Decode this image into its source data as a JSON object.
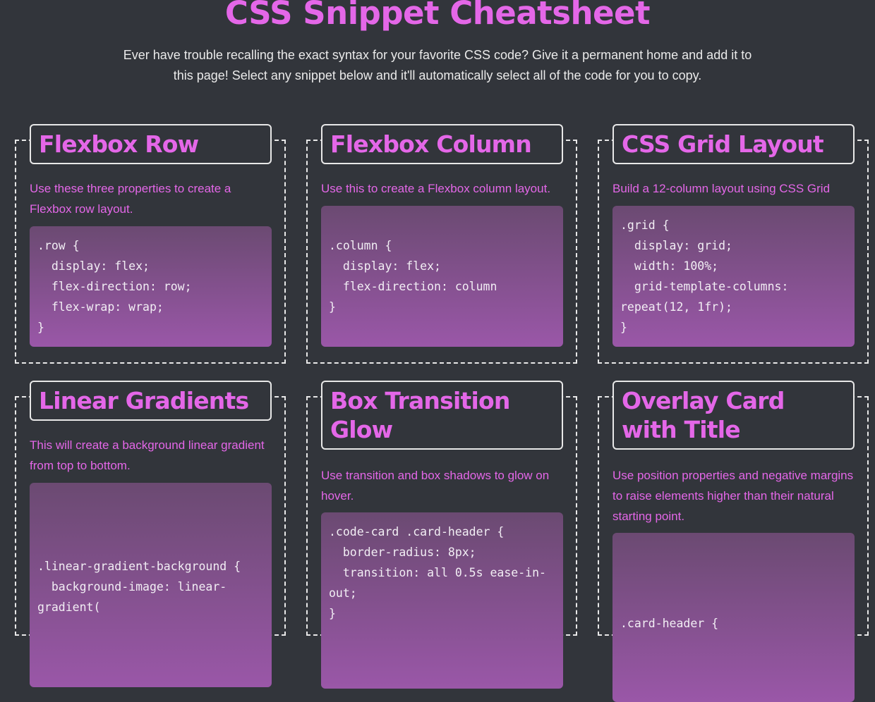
{
  "page": {
    "title": "CSS Snippet Cheatsheet",
    "intro": "Ever have trouble recalling the exact syntax for your favorite CSS code? Give it a permanent home and add it to this page! Select any snippet below and it'll automatically select all of the code for you to copy."
  },
  "cards": [
    {
      "title": "Flexbox Row",
      "description": "Use these three properties to create a Flexbox row layout.",
      "code": ".row {\n  display: flex;\n  flex-direction: row;\n  flex-wrap: wrap;\n}"
    },
    {
      "title": "Flexbox Column",
      "description": "Use this to create a Flexbox column layout.",
      "code": ".column {\n  display: flex;\n  flex-direction: column\n}"
    },
    {
      "title": "CSS Grid Layout",
      "description": "Build a 12-column layout using CSS Grid",
      "code": ".grid {\n  display: grid;\n  width: 100%;\n  grid-template-columns: repeat(12, 1fr);\n}"
    },
    {
      "title": "Linear Gradients",
      "description": "This will create a background linear gradient from top to bottom.",
      "code": ".linear-gradient-background {\n  background-image: linear-gradient("
    },
    {
      "title": "Box Transition Glow",
      "description": "Use transition and box shadows to glow on hover.",
      "code": ".code-card .card-header {\n  border-radius: 8px;\n  transition: all 0.5s ease-in-out;\n}"
    },
    {
      "title": "Overlay Card with Title",
      "description": "Use position properties and negative margins to raise elements higher than their natural starting point.",
      "code": ".card-header {"
    }
  ]
}
